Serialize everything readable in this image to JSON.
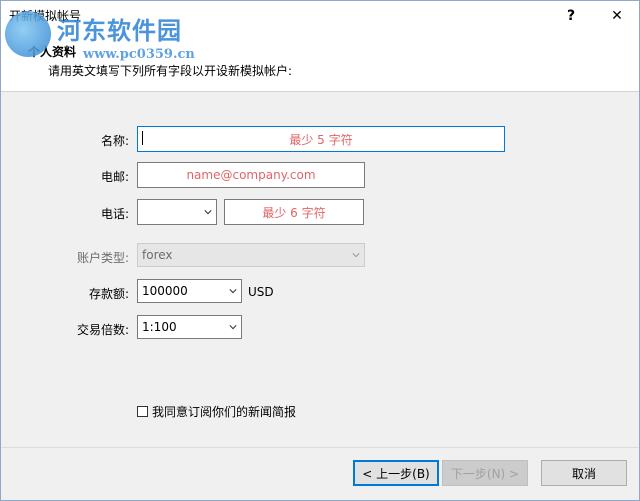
{
  "window": {
    "title": "开新模拟帐号",
    "help_label": "?",
    "close_label": "✕"
  },
  "watermark": {
    "text": "河东软件园",
    "url": "www.pc0359.cn"
  },
  "header": {
    "title": "个人资料",
    "subtitle": "请用英文填写下列所有字段以开设新模拟帐户:"
  },
  "form": {
    "name": {
      "label": "名称:",
      "placeholder": "最少 5 字符",
      "value": ""
    },
    "email": {
      "label": "电邮:",
      "placeholder": "name@company.com",
      "value": ""
    },
    "phone": {
      "label": "电话:",
      "country_code": "",
      "placeholder": "最少 6 字符",
      "value": ""
    },
    "account_type": {
      "label": "账户类型:",
      "value": "forex",
      "disabled": true
    },
    "deposit": {
      "label": "存款额:",
      "value": "100000",
      "currency": "USD"
    },
    "leverage": {
      "label": "交易倍数:",
      "value": "1:100"
    },
    "newsletter": {
      "label": "我同意订阅你们的新闻简报",
      "checked": false
    }
  },
  "footer": {
    "back_label": "< 上一步(B)",
    "next_label": "下一步(N) >",
    "cancel_label": "取消"
  },
  "colors": {
    "placeholder": "#e06666",
    "focus_border": "#0078d7",
    "watermark": "#2c82d6"
  }
}
